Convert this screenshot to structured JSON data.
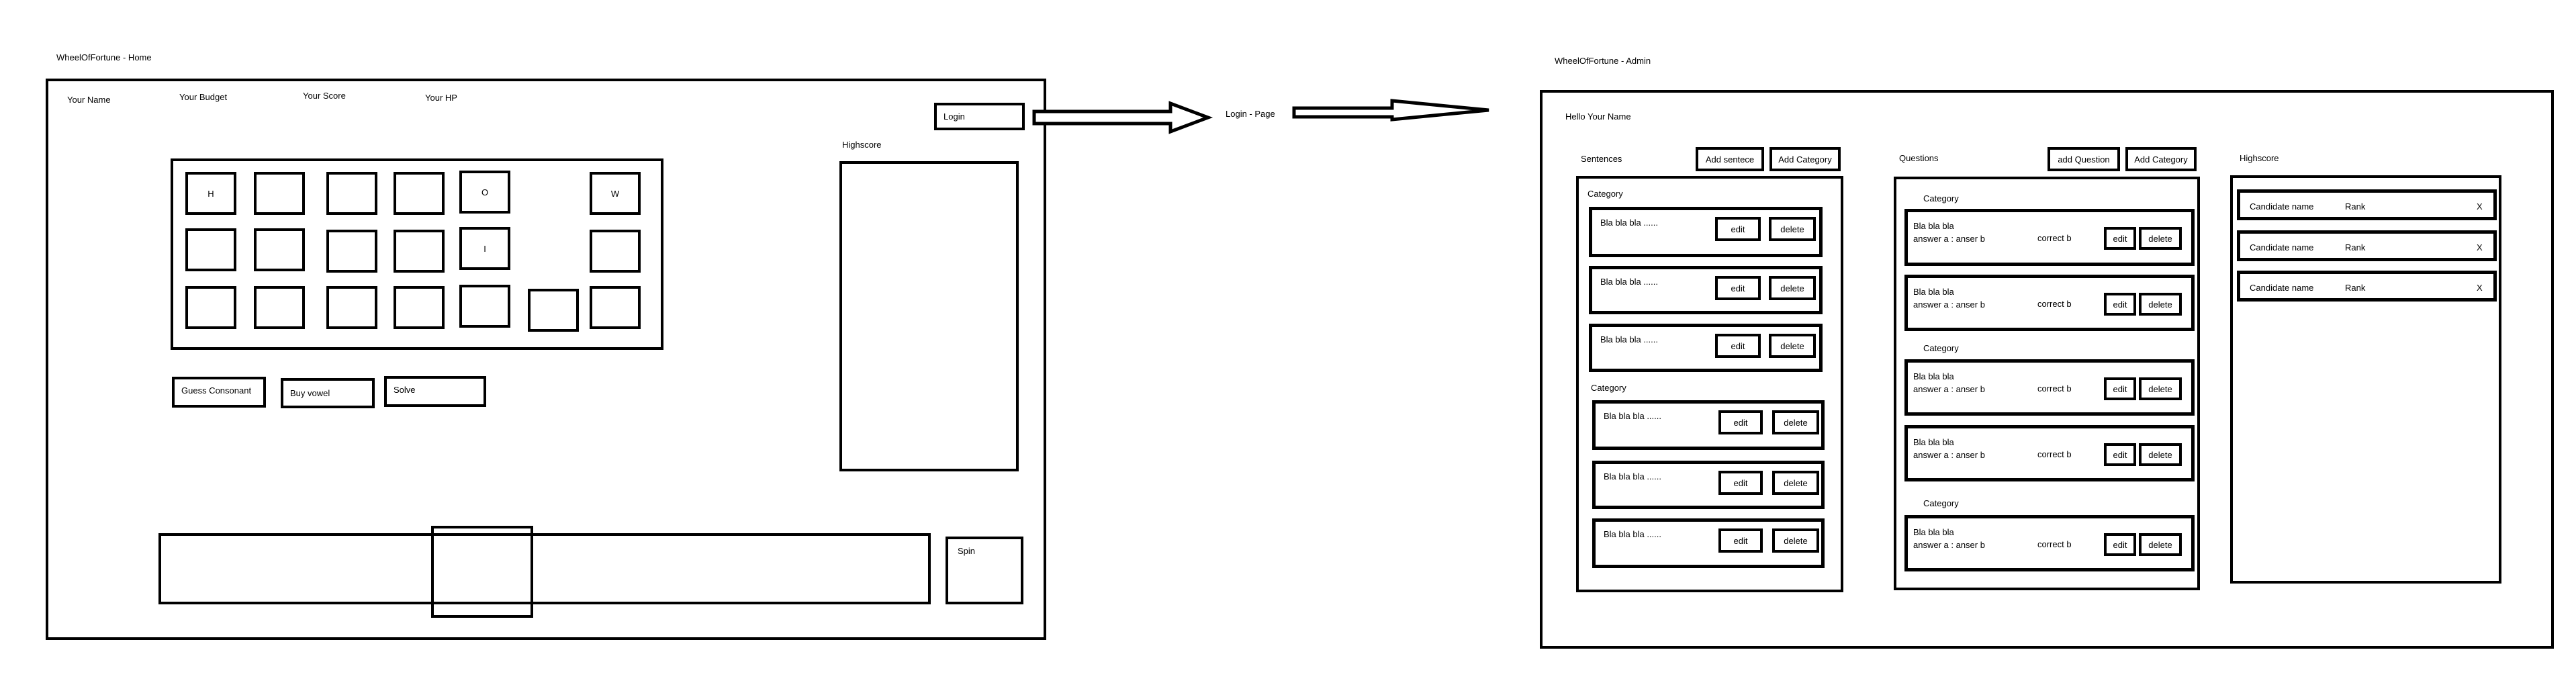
{
  "home": {
    "title": "WheelOfFortune - Home",
    "header": {
      "your_name": "Your Name",
      "your_budget": "Your Budget",
      "your_score": "Your Score",
      "your_hp": "Your HP"
    },
    "login_label": "Login",
    "highscore_label": "Highscore",
    "tiles": {
      "r1c1": "H",
      "r1c5": "O",
      "r1c7": "W",
      "r2c5": "I"
    },
    "actions": {
      "guess_consonant": "Guess Consonant",
      "buy_vowel": "Buy vowel",
      "solve": "Solve"
    },
    "spin_label": "Spin"
  },
  "login_page_label": "Login - Page",
  "admin": {
    "title": "WheelOfFortune - Admin",
    "greeting": "Hello Your Name",
    "sentences": {
      "label": "Sentences",
      "add_sentence": "Add sentece",
      "add_category": "Add Category",
      "groups": [
        {
          "category": "Category",
          "items": [
            "Bla bla bla ......",
            "Bla bla bla ......",
            "Bla bla bla ......"
          ]
        },
        {
          "category": "Category",
          "items": [
            "Bla bla bla ......",
            "Bla bla bla ......",
            "Bla bla bla ......"
          ]
        }
      ]
    },
    "questions": {
      "label": "Questions",
      "add_question": "add Question",
      "add_category": "Add Category",
      "groups": [
        {
          "category": "Category",
          "items": [
            {
              "q": "Bla bla bla",
              "answers": "answer a : anser b",
              "correct": "correct b"
            },
            {
              "q": "Bla bla bla",
              "answers": "answer a : anser b",
              "correct": "correct b"
            }
          ]
        },
        {
          "category": "Category",
          "items": [
            {
              "q": "Bla bla bla",
              "answers": "answer a : anser b",
              "correct": "correct b"
            },
            {
              "q": "Bla bla bla",
              "answers": "answer a : anser b",
              "correct": "correct b"
            }
          ]
        },
        {
          "category": "Category",
          "items": [
            {
              "q": "Bla bla bla",
              "answers": "answer a : anser b",
              "correct": "correct b"
            }
          ]
        }
      ]
    },
    "highscore": {
      "label": "Highscore",
      "rows": [
        {
          "name": "Candidate name",
          "rank": "Rank",
          "remove": "X"
        },
        {
          "name": "Candidate name",
          "rank": "Rank",
          "remove": "X"
        },
        {
          "name": "Candidate name",
          "rank": "Rank",
          "remove": "X"
        }
      ]
    },
    "edit_label": "edit",
    "delete_label": "delete"
  }
}
